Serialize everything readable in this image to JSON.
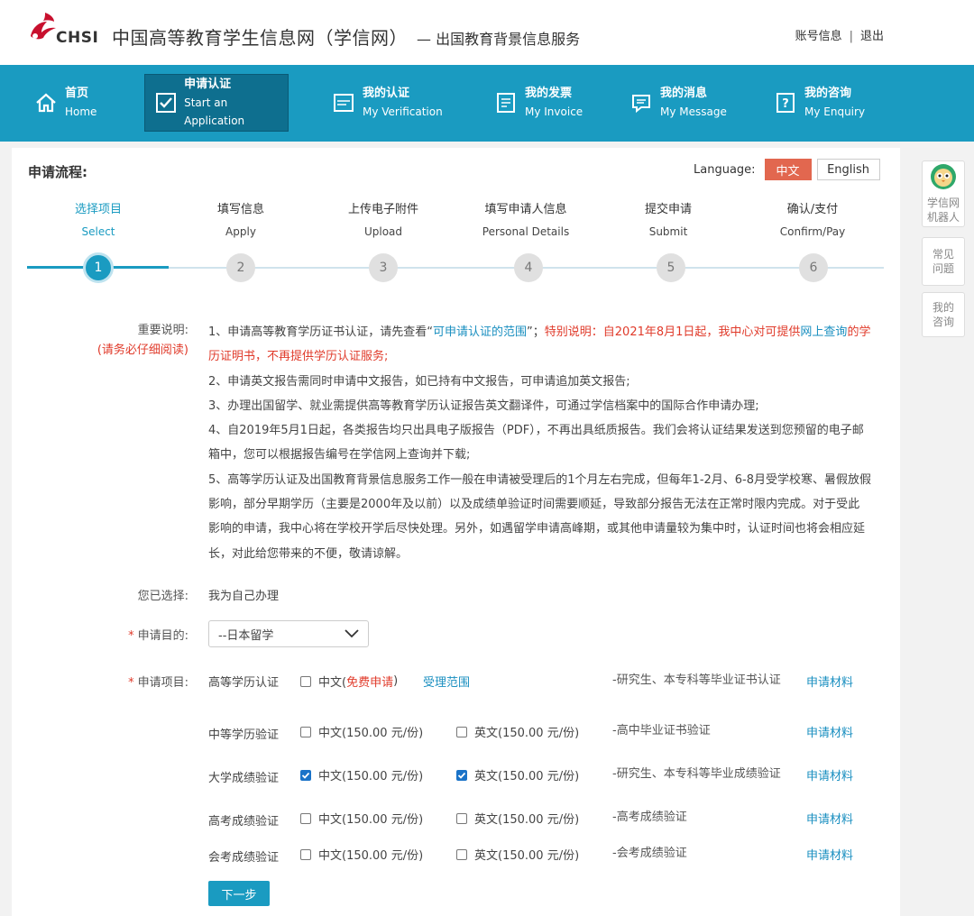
{
  "header": {
    "logo_text": "CHSI",
    "site_title": "中国高等教育学生信息网（学信网）",
    "site_subtitle": "— 出国教育背景信息服务",
    "account_info": "账号信息",
    "separator": "|",
    "logout": "退出",
    "brand_color": "#c8102e"
  },
  "nav": {
    "color": "#1a9bc1",
    "items": [
      {
        "zh": "首页",
        "en": "Home",
        "icon": "home-icon"
      },
      {
        "zh": "申请认证",
        "en": "Start an Application",
        "icon": "checkbox-icon",
        "active": true
      },
      {
        "zh": "我的认证",
        "en": "My Verification",
        "icon": "certificate-icon"
      },
      {
        "zh": "我的发票",
        "en": "My Invoice",
        "icon": "invoice-icon"
      },
      {
        "zh": "我的消息",
        "en": "My Message",
        "icon": "message-icon"
      },
      {
        "zh": "我的咨询",
        "en": "My Enquiry",
        "icon": "question-icon"
      }
    ]
  },
  "flow": {
    "title": "申请流程:",
    "language_label": "Language:",
    "lang_zh": "中文",
    "lang_en": "English",
    "steps": [
      {
        "zh": "选择项目",
        "en": "Select",
        "num": "1"
      },
      {
        "zh": "填写信息",
        "en": "Apply",
        "num": "2"
      },
      {
        "zh": "上传电子附件",
        "en": "Upload",
        "num": "3"
      },
      {
        "zh": "填写申请人信息",
        "en": "Personal Details",
        "num": "4"
      },
      {
        "zh": "提交申请",
        "en": "Submit",
        "num": "5"
      },
      {
        "zh": "确认/支付",
        "en": "Confirm/Pay",
        "num": "6"
      }
    ],
    "current_step": 1
  },
  "notice": {
    "label": "重要说明:",
    "label_note": "(请务必仔细阅读)",
    "p1_a": "1、申请高等教育学历证书认证，请先查看“",
    "p1_link": "可申请认证的范围",
    "p1_b": "”；",
    "p1_red1": "特别说明：自2021年8月1日起，我中心对可提供",
    "p1_link2": "网上查询",
    "p1_red2": "的学历证明书，不再提供学历认证服务;",
    "p2": "2、申请英文报告需同时申请中文报告，如已持有中文报告，可申请追加英文报告;",
    "p3": "3、办理出国留学、就业需提供高等教育学历认证报告英文翻译件，可通过学信档案中的国际合作申请办理;",
    "p4": "4、自2019年5月1日起，各类报告均只出具电子版报告（PDF），不再出具纸质报告。我们会将认证结果发送到您预留的电子邮箱中，您可以根据报告编号在学信网上查询并下载;",
    "p5": "5、高等学历认证及出国教育背景信息服务工作一般在申请被受理后的1个月左右完成，但每年1-2月、6-8月受学校寒、暑假放假影响，部分早期学历（主要是2000年及以前）以及成绩单验证时间需要顺延，导致部分报告无法在正常时限内完成。对于受此影响的申请，我中心将在学校开学后尽快处理。另外，如遇留学申请高峰期，或其他申请量较为集中时，认证时间也将会相应延长，对此给您带来的不便，敬请谅解。"
  },
  "form": {
    "selected_label": "您已选择:",
    "selected_value": "我为自己办理",
    "purpose_label": "申请目的:",
    "purpose_value": "--日本留学",
    "items_label": "申请项目:",
    "required_mark": "*",
    "items": [
      {
        "name": "高等学历认证",
        "zh": "中文(",
        "zh_free": "免费申请",
        "zh_close": ")",
        "zh_checked": false,
        "range": "受理范围",
        "desc": "-研究生、本专科等毕业证书认证",
        "material": "申请材料"
      },
      {
        "name": "中等学历验证",
        "zh": "中文(150.00 元/份)",
        "zh_checked": false,
        "en": "英文(150.00 元/份)",
        "en_checked": false,
        "desc": "-高中毕业证书验证",
        "material": "申请材料"
      },
      {
        "name": "大学成绩验证",
        "zh": "中文(150.00 元/份)",
        "zh_checked": true,
        "en": "英文(150.00 元/份)",
        "en_checked": true,
        "desc": "-研究生、本专科等毕业成绩验证",
        "material": "申请材料"
      },
      {
        "name": "高考成绩验证",
        "zh": "中文(150.00 元/份)",
        "zh_checked": false,
        "en": "英文(150.00 元/份)",
        "en_checked": false,
        "desc": "-高考成绩验证",
        "material": "申请材料"
      },
      {
        "name": "会考成绩验证",
        "zh": "中文(150.00 元/份)",
        "zh_checked": false,
        "en": "英文(150.00 元/份)",
        "en_checked": false,
        "desc": "-会考成绩验证",
        "material": "申请材料"
      }
    ],
    "next_button": "下一步"
  },
  "side": {
    "robot_l1": "学信网",
    "robot_l2": "机器人",
    "faq_l1": "常见",
    "faq_l2": "问题",
    "enquiry_l1": "我的",
    "enquiry_l2": "咨询"
  }
}
